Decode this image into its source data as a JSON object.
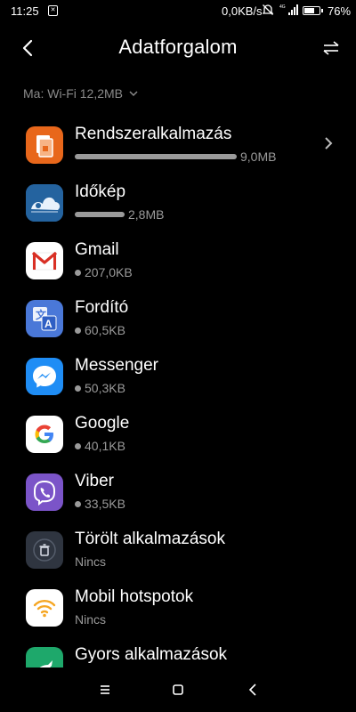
{
  "status_bar": {
    "time": "11:25",
    "net_speed": "0,0KB/s",
    "network_type": "4G",
    "battery_pct": "76%",
    "battery_level": 0.76,
    "icons": [
      "sim-icon",
      "alarm-off-icon",
      "signal-icon",
      "battery-icon"
    ]
  },
  "header": {
    "title": "Adatforgalom",
    "back_icon": "back-arrow-icon",
    "sort_icon": "sort-icon"
  },
  "filter": {
    "label": "Ma: Wi-Fi 12,2MB"
  },
  "apps": [
    {
      "name": "Rendszeralkalmazás",
      "usage": "9,0MB",
      "share": 1.0,
      "icon": "system-apps-icon",
      "color": "#e8671b",
      "has_chevron": true
    },
    {
      "name": "Időkép",
      "usage": "2,8MB",
      "share": 0.31,
      "icon": "idokep-icon",
      "color": "#2a6aa8"
    },
    {
      "name": "Gmail",
      "usage": "207,0KB",
      "share": 0,
      "icon": "gmail-icon",
      "color": "#ffffff"
    },
    {
      "name": "Fordító",
      "usage": "60,5KB",
      "share": 0,
      "icon": "translate-icon",
      "color": "#4a78d8"
    },
    {
      "name": "Messenger",
      "usage": "50,3KB",
      "share": 0,
      "icon": "messenger-icon",
      "color": "#1f8df5"
    },
    {
      "name": "Google",
      "usage": "40,1KB",
      "share": 0,
      "icon": "google-icon",
      "color": "#ffffff"
    },
    {
      "name": "Viber",
      "usage": "33,5KB",
      "share": 0,
      "icon": "viber-icon",
      "color": "#7b54c8"
    },
    {
      "name": "Törölt alkalmazások",
      "usage": "Nincs",
      "share": null,
      "icon": "deleted-apps-icon",
      "color": "#2f3540"
    },
    {
      "name": "Mobil hotspotok",
      "usage": "Nincs",
      "share": null,
      "icon": "hotspot-icon",
      "color": "#ffffff"
    },
    {
      "name": "Gyors alkalmazások",
      "usage": "",
      "share": null,
      "icon": "quick-apps-icon",
      "color": "#1ea86b"
    }
  ],
  "nav": {
    "icons": [
      "menu-icon",
      "home-icon",
      "back-icon"
    ]
  }
}
